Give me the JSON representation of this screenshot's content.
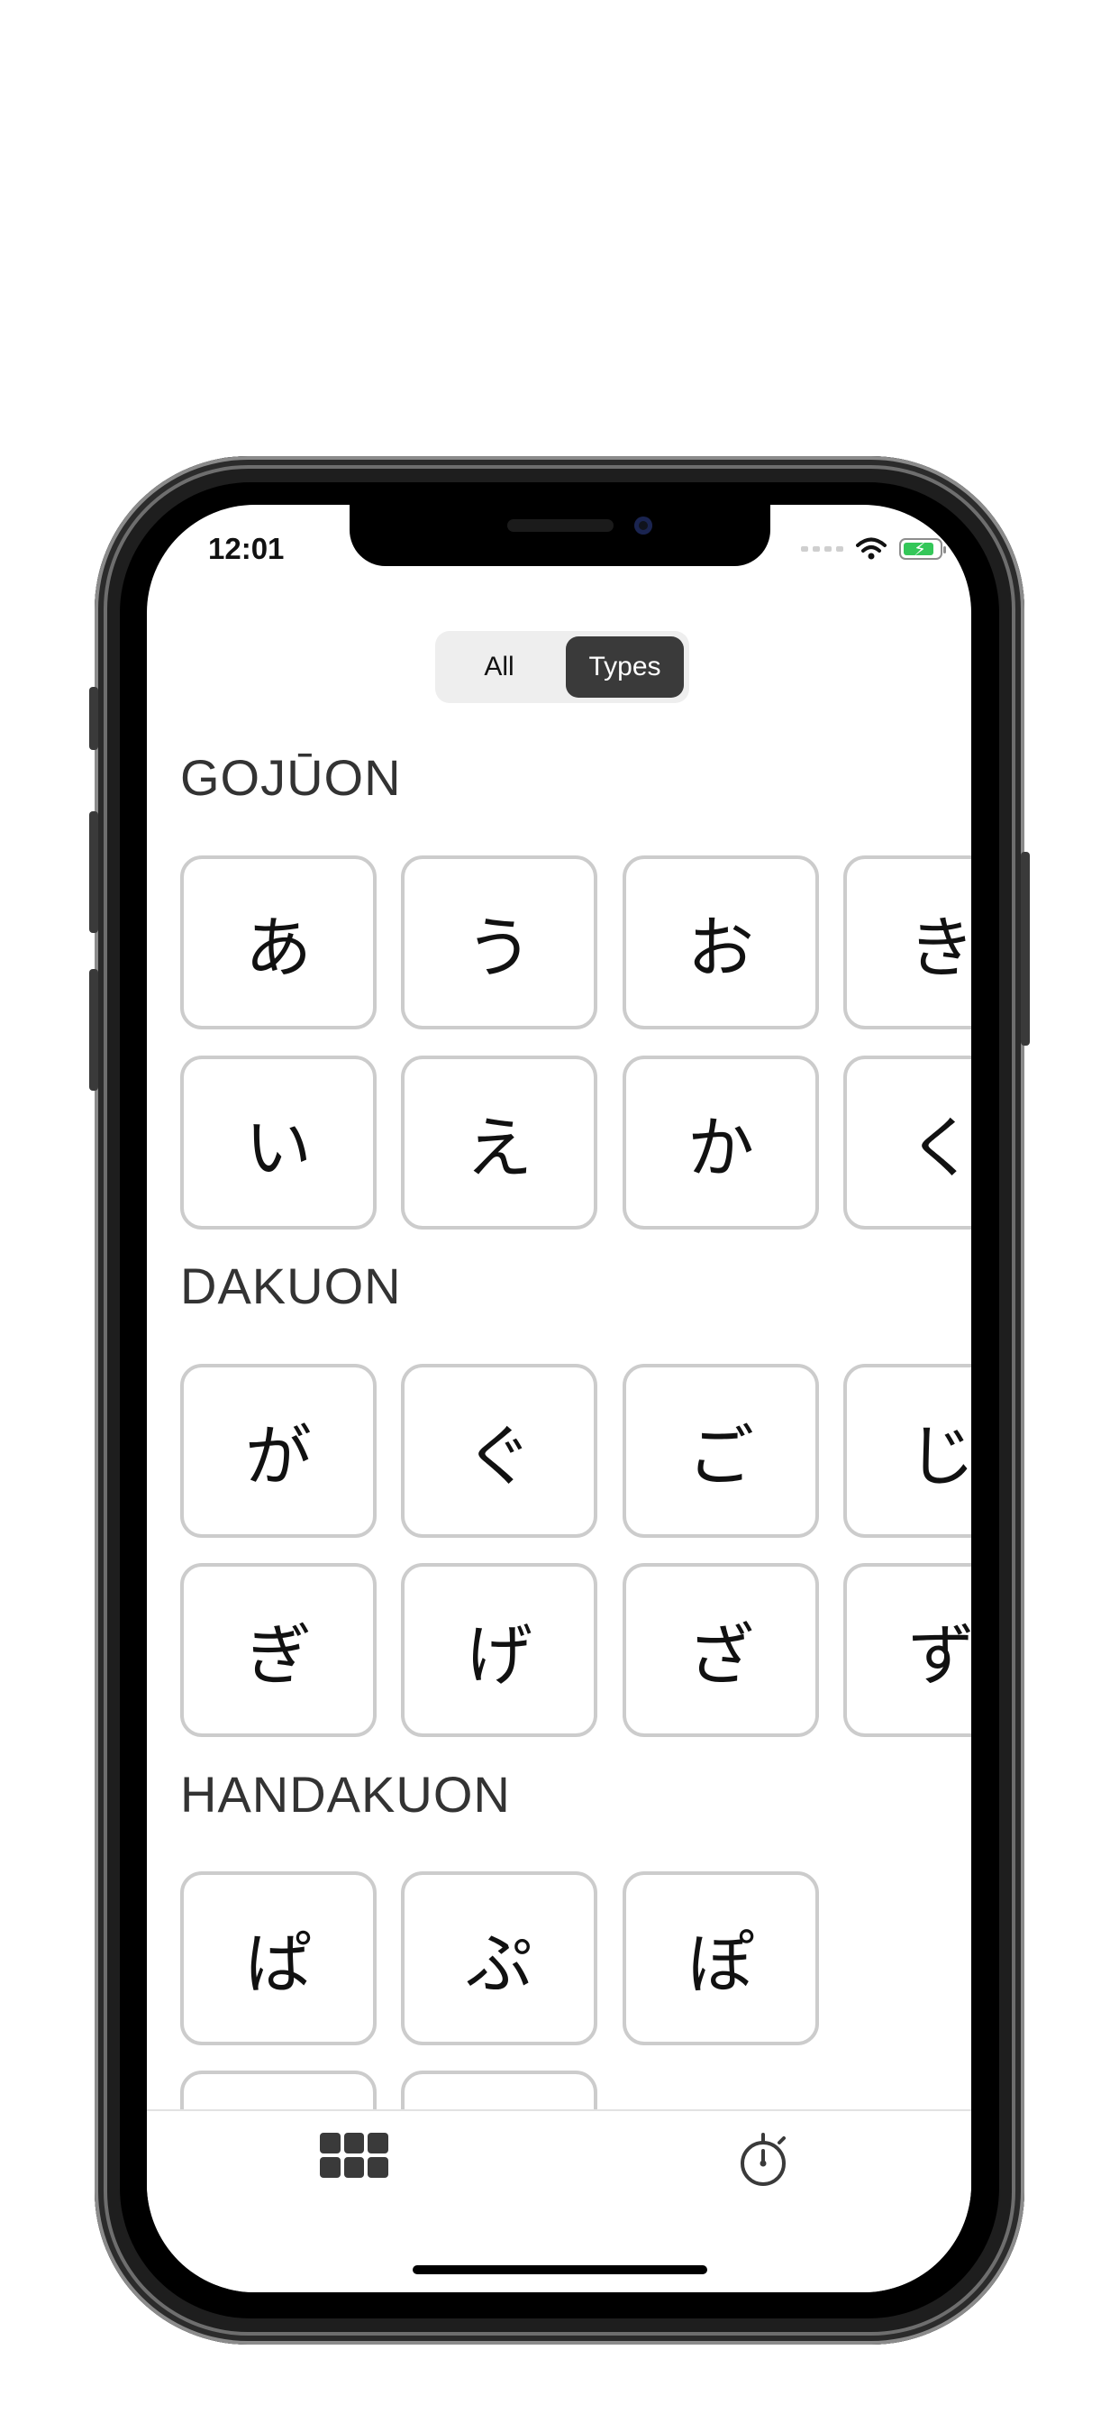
{
  "status_bar": {
    "time": "12:01"
  },
  "segmented_control": {
    "options": [
      "All",
      "Types"
    ],
    "selected": "Types"
  },
  "sections": [
    {
      "title": "GOJŪON",
      "cards": [
        "あ",
        "う",
        "お",
        "き",
        "い",
        "え",
        "か",
        "く"
      ]
    },
    {
      "title": "DAKUON",
      "cards": [
        "が",
        "ぐ",
        "ご",
        "じ",
        "ぎ",
        "げ",
        "ざ",
        "ず"
      ]
    },
    {
      "title": "HANDAKUON",
      "cards": [
        "ぱ",
        "ぷ",
        "ぽ",
        "",
        ""
      ]
    }
  ],
  "tabbar": {
    "items": [
      "grid-icon",
      "stopwatch-icon"
    ]
  },
  "colors": {
    "accent": "#3a3a3a",
    "card_border": "#cccccc",
    "battery": "#34c759"
  }
}
